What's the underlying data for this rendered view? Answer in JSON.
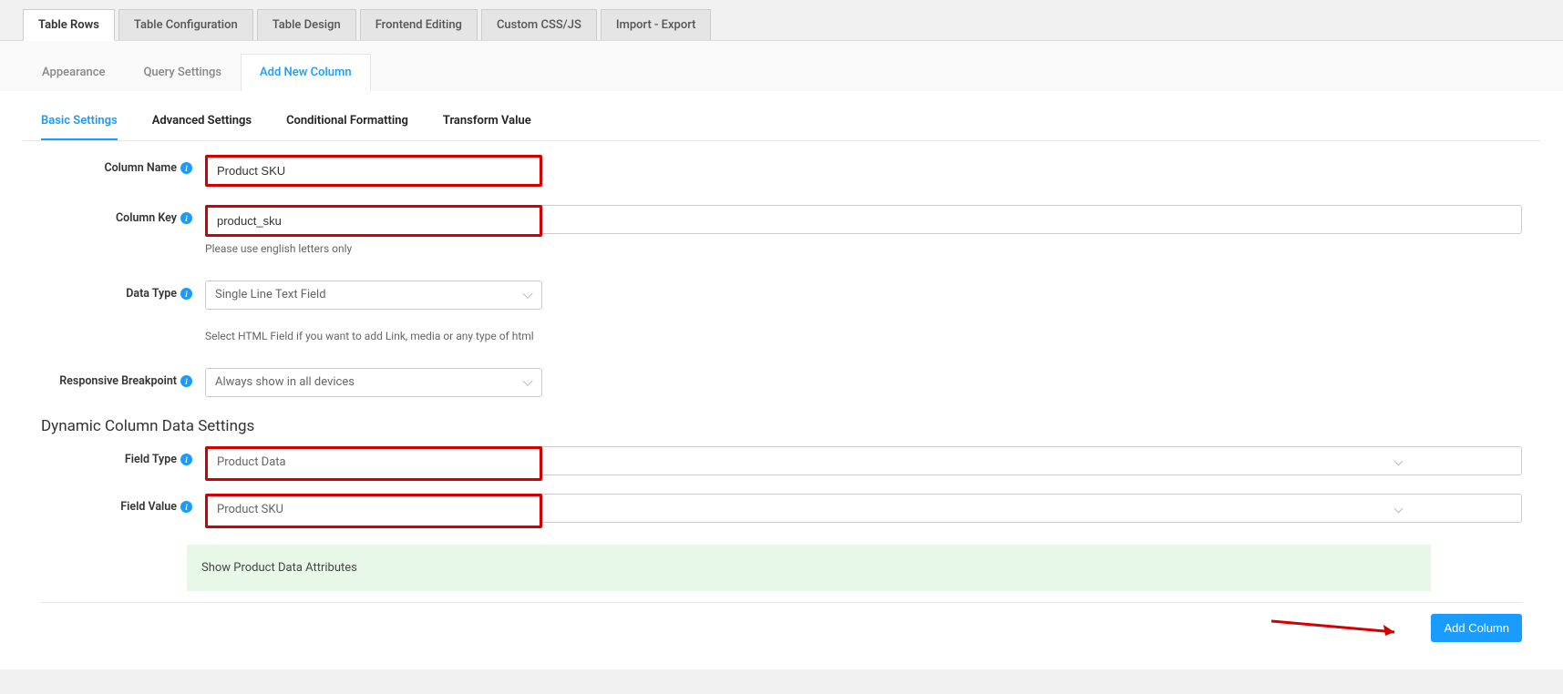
{
  "top_tabs": {
    "rows": "Table Rows",
    "config": "Table Configuration",
    "design": "Table Design",
    "frontend": "Frontend Editing",
    "css": "Custom CSS/JS",
    "import": "Import - Export"
  },
  "sub_tabs": {
    "appearance": "Appearance",
    "query": "Query Settings",
    "add_col": "Add New Column"
  },
  "section_tabs": {
    "basic": "Basic Settings",
    "advanced": "Advanced Settings",
    "conditional": "Conditional Formatting",
    "transform": "Transform Value"
  },
  "labels": {
    "column_name": "Column Name",
    "column_key": "Column Key",
    "data_type": "Data Type",
    "responsive": "Responsive Breakpoint",
    "field_type": "Field Type",
    "field_value": "Field Value"
  },
  "values": {
    "column_name": "Product SKU",
    "column_key": "product_sku",
    "data_type": "Single Line Text Field",
    "responsive": "Always show in all devices",
    "field_type": "Product Data",
    "field_value": "Product SKU"
  },
  "help": {
    "column_key": "Please use english letters only",
    "data_type": "Select HTML Field if you want to add Link, media or any type of html"
  },
  "headings": {
    "dynamic": "Dynamic Column Data Settings"
  },
  "banner": {
    "attrs": "Show Product Data Attributes"
  },
  "buttons": {
    "add_column": "Add Column"
  },
  "info_icon": "i"
}
